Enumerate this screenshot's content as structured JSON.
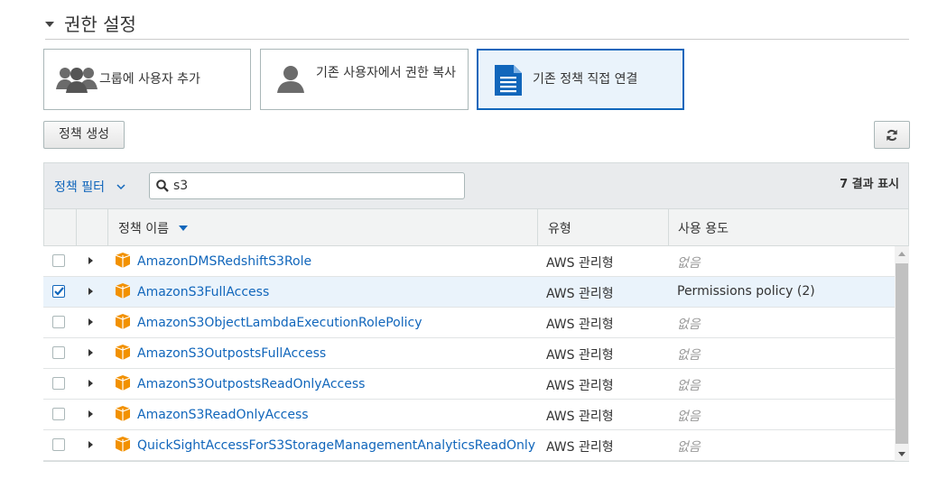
{
  "section": {
    "title": "권한 설정"
  },
  "options": {
    "add_to_group": "그룹에 사용자 추가",
    "copy_from_user": "기존 사용자에서 권한 복사",
    "attach_policies": "기존 정책 직접 연결"
  },
  "toolbar": {
    "create_policy_label": "정책 생성",
    "filter_label": "정책 필터",
    "search_value": "s3",
    "result_count": "7 결과 표시"
  },
  "table": {
    "headers": {
      "name": "정책 이름",
      "type": "유형",
      "usage": "사용 용도"
    },
    "rows": [
      {
        "name": "AmazonDMSRedshiftS3Role",
        "type": "AWS 관리형",
        "usage": "없음",
        "checked": false
      },
      {
        "name": "AmazonS3FullAccess",
        "type": "AWS 관리형",
        "usage": "Permissions policy (2)",
        "checked": true
      },
      {
        "name": "AmazonS3ObjectLambdaExecutionRolePolicy",
        "type": "AWS 관리형",
        "usage": "없음",
        "checked": false
      },
      {
        "name": "AmazonS3OutpostsFullAccess",
        "type": "AWS 관리형",
        "usage": "없음",
        "checked": false
      },
      {
        "name": "AmazonS3OutpostsReadOnlyAccess",
        "type": "AWS 관리형",
        "usage": "없음",
        "checked": false
      },
      {
        "name": "AmazonS3ReadOnlyAccess",
        "type": "AWS 관리형",
        "usage": "없음",
        "checked": false
      },
      {
        "name": "QuickSightAccessForS3StorageManagementAnalyticsReadOnly",
        "type": "AWS 관리형",
        "usage": "없음",
        "checked": false
      }
    ]
  },
  "colors": {
    "accent": "#1166bb",
    "selected_bg": "#eaf3fb",
    "aws_orange": "#f29100"
  },
  "icons": [
    "caret-down-icon",
    "users-group-icon",
    "user-icon",
    "document-icon",
    "refresh-icon",
    "search-icon",
    "chevron-down-icon",
    "expand-arrow-icon",
    "aws-policy-box-icon"
  ]
}
